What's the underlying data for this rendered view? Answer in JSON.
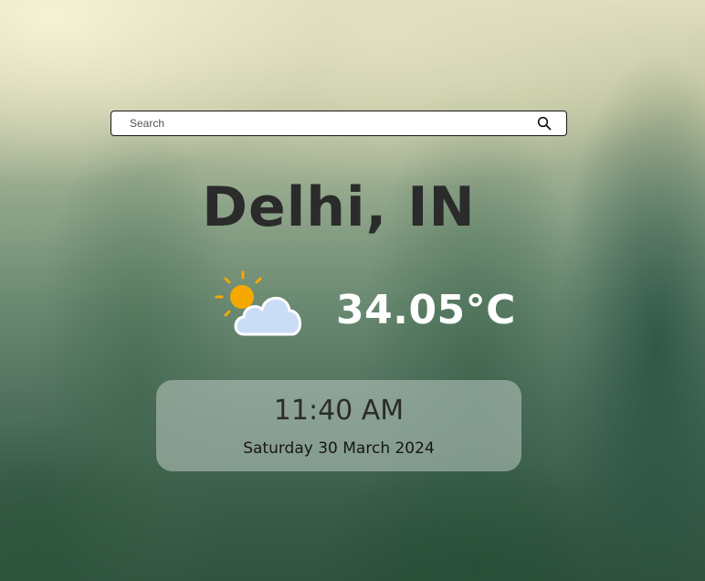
{
  "search": {
    "placeholder": "Search",
    "value": "",
    "button_icon": "search-icon"
  },
  "location": {
    "city": "Delhi, IN"
  },
  "weather": {
    "icon": "partly-cloudy-icon",
    "temperature": "34.05°C"
  },
  "clock": {
    "time": "11:40 AM",
    "date": "Saturday 30 March 2024"
  },
  "colors": {
    "sun": "#F5A800",
    "cloud_fill": "#C9DDF7",
    "cloud_stroke": "#FFFFFF",
    "temperature_text": "#FFFFFF",
    "city_text": "#2B2B2B"
  }
}
